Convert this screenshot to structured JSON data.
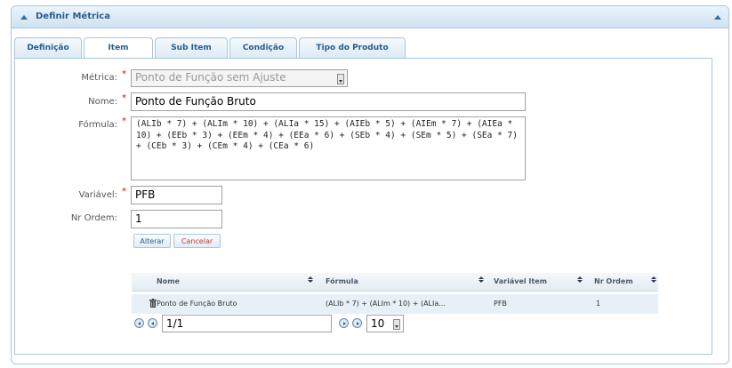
{
  "panel": {
    "title": "Definir Métrica"
  },
  "tabs": [
    {
      "label": "Definição"
    },
    {
      "label": "Item"
    },
    {
      "label": "Sub Item"
    },
    {
      "label": "Condição"
    },
    {
      "label": "Tipo do Produto"
    }
  ],
  "form": {
    "metrica_label": "Métrica:",
    "metrica_value": "Ponto de Função sem Ajuste",
    "nome_label": "Nome:",
    "nome_value": "Ponto de Função Bruto",
    "formula_label": "Fórmula:",
    "formula_value": "(ALIb * 7) + (ALIm * 10) + (ALIa * 15) + (AIEb * 5) + (AIEm * 7) + (AIEa * 10) + (EEb * 3) + (EEm * 4) + (EEa * 6) + (SEb * 4) + (SEm * 5) + (SEa * 7) + (CEb * 3) + (CEm * 4) + (CEa * 6)",
    "variavel_label": "Variável:",
    "variavel_value": "PFB",
    "ordem_label": "Nr Ordem:",
    "ordem_value": "1",
    "required_mark": "*",
    "alterar_label": "Alterar",
    "cancelar_label": "Cancelar"
  },
  "grid": {
    "columns": [
      "Nome",
      "Fórmula",
      "Variável Item",
      "Nr Ordem"
    ],
    "rows": [
      {
        "nome": "Ponto de Função Bruto",
        "formula": "(ALIb * 7) + (ALIm * 10) + (ALIa...",
        "variavel": "PFB",
        "ordem": "1"
      }
    ]
  },
  "pager": {
    "page": "1/1",
    "page_size": "10"
  }
}
